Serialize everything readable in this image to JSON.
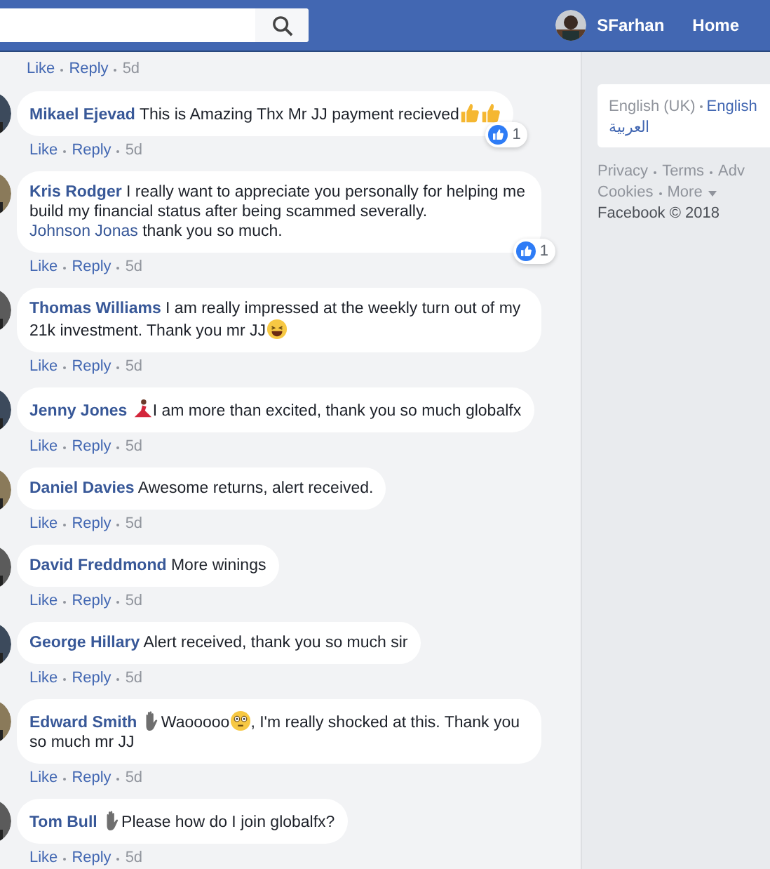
{
  "header": {
    "user_name": "SFarhan",
    "home": "Home"
  },
  "partial_comment": {
    "like": "Like",
    "reply": "Reply",
    "time": "5d"
  },
  "comments": [
    {
      "name": "Mikael Ejevad",
      "parts": [
        {
          "kind": "text",
          "text": "This is Amazing Thx Mr JJ payment recieved"
        },
        {
          "kind": "thumbs"
        },
        {
          "kind": "thumbs"
        }
      ],
      "reaction_count": "1",
      "like": "Like",
      "reply": "Reply",
      "time": "5d"
    },
    {
      "name": "Kris Rodger",
      "parts": [
        {
          "kind": "text",
          "text": "I really want to appreciate you personally for helping me build my financial status after being scammed severally."
        },
        {
          "kind": "link",
          "text": "Johnson Jonas"
        },
        {
          "kind": "text",
          "text": "thank you so much."
        }
      ],
      "reaction_count": "1",
      "like": "Like",
      "reply": "Reply",
      "time": "5d"
    },
    {
      "name": "Thomas Williams",
      "parts": [
        {
          "kind": "text",
          "text": "I am really impressed at the weekly turn out of my 21k investment. Thank you mr JJ"
        },
        {
          "kind": "laugh"
        }
      ],
      "like": "Like",
      "reply": "Reply",
      "time": "5d"
    },
    {
      "name": "Jenny Jones",
      "parts": [
        {
          "kind": "dancer"
        },
        {
          "kind": "text",
          "text": "I am more than excited, thank you so much globalfx"
        }
      ],
      "like": "Like",
      "reply": "Reply",
      "time": "5d"
    },
    {
      "name": "Daniel Davies",
      "parts": [
        {
          "kind": "text",
          "text": "Awesome returns, alert received."
        }
      ],
      "like": "Like",
      "reply": "Reply",
      "time": "5d"
    },
    {
      "name": "David Freddmond",
      "parts": [
        {
          "kind": "text",
          "text": "More winings"
        }
      ],
      "like": "Like",
      "reply": "Reply",
      "time": "5d"
    },
    {
      "name": "George Hillary",
      "parts": [
        {
          "kind": "text",
          "text": "Alert received, thank you so much sir"
        }
      ],
      "like": "Like",
      "reply": "Reply",
      "time": "5d"
    },
    {
      "name": "Edward Smith",
      "parts": [
        {
          "kind": "hand"
        },
        {
          "kind": "text",
          "text": "Waooooo"
        },
        {
          "kind": "flushed"
        },
        {
          "kind": "text",
          "text": ", I'm really shocked at this. Thank you so much mr JJ"
        }
      ],
      "like": "Like",
      "reply": "Reply",
      "time": "5d"
    },
    {
      "name": "Tom Bull",
      "parts": [
        {
          "kind": "hand"
        },
        {
          "kind": "text",
          "text": "Please how do I join globalfx?"
        }
      ],
      "like": "Like",
      "reply": "Reply",
      "time": "5d"
    }
  ],
  "sidebar": {
    "languages": [
      {
        "text": "English (UK)",
        "selected": true
      },
      {
        "text": "English",
        "selected": false
      }
    ],
    "arabic": "العربية",
    "footer_links": [
      {
        "text": "Privacy"
      },
      {
        "text": "Terms"
      },
      {
        "text": "Adv"
      }
    ],
    "footer_links_2": [
      {
        "text": "Cookies"
      },
      {
        "text": "More"
      }
    ],
    "copyright": "Facebook © 2018"
  }
}
